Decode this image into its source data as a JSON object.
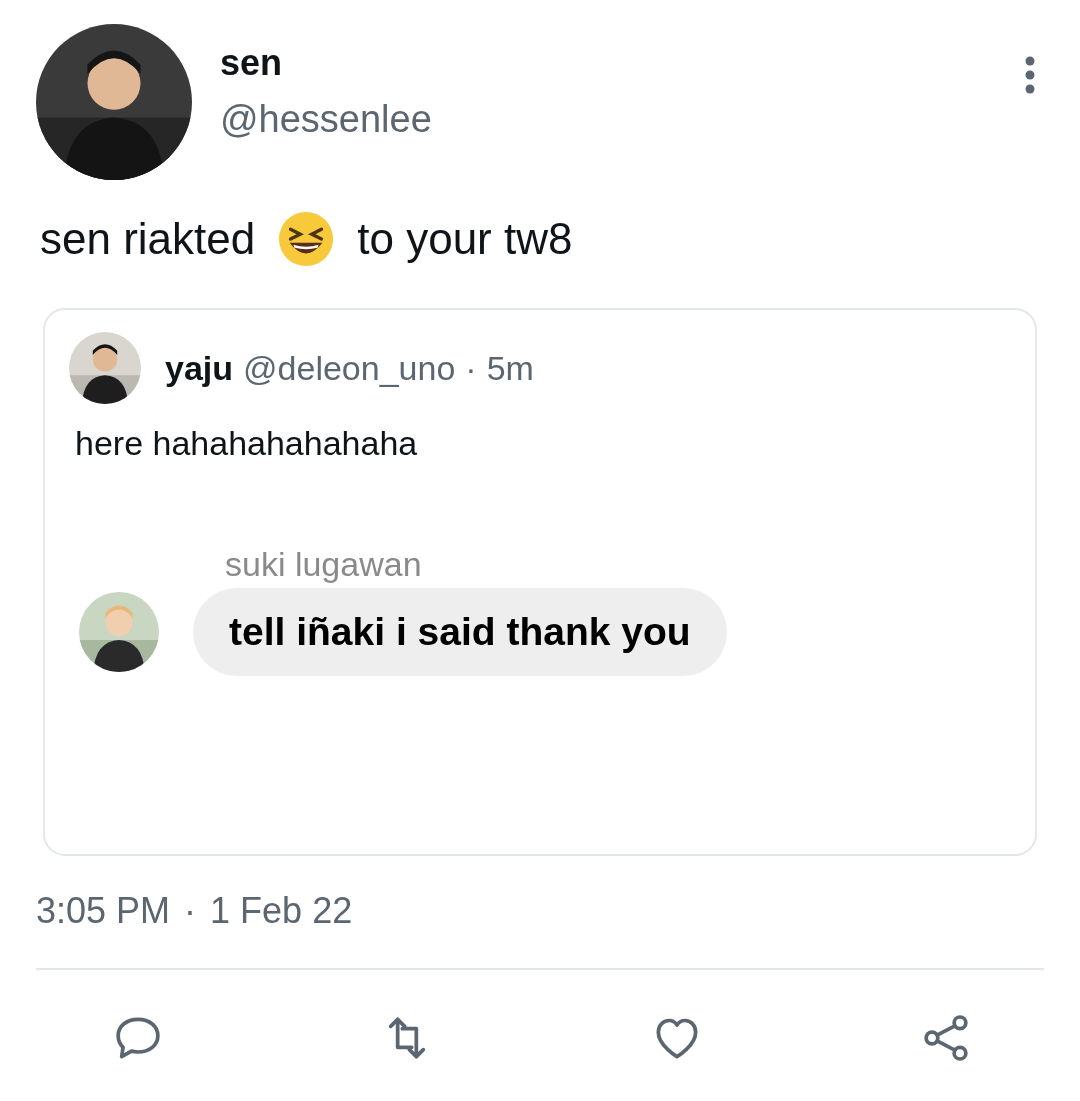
{
  "author": {
    "name": "sen",
    "handle": "@hessenlee"
  },
  "tweet": {
    "before": "sen riakted",
    "after": "to your tw8"
  },
  "quote": {
    "name": "yaju",
    "handle": "@deleon_uno",
    "separator": "·",
    "time": "5m",
    "text": "here hahahahahahaha",
    "chat": {
      "sender": "suki lugawan",
      "message": "tell iñaki i said thank you"
    }
  },
  "timestamp": {
    "time": "3:05 PM",
    "separator": "·",
    "date": "1 Feb 22"
  },
  "actions": [
    {
      "kind": "reply"
    },
    {
      "kind": "retweet"
    },
    {
      "kind": "like"
    },
    {
      "kind": "share"
    }
  ]
}
